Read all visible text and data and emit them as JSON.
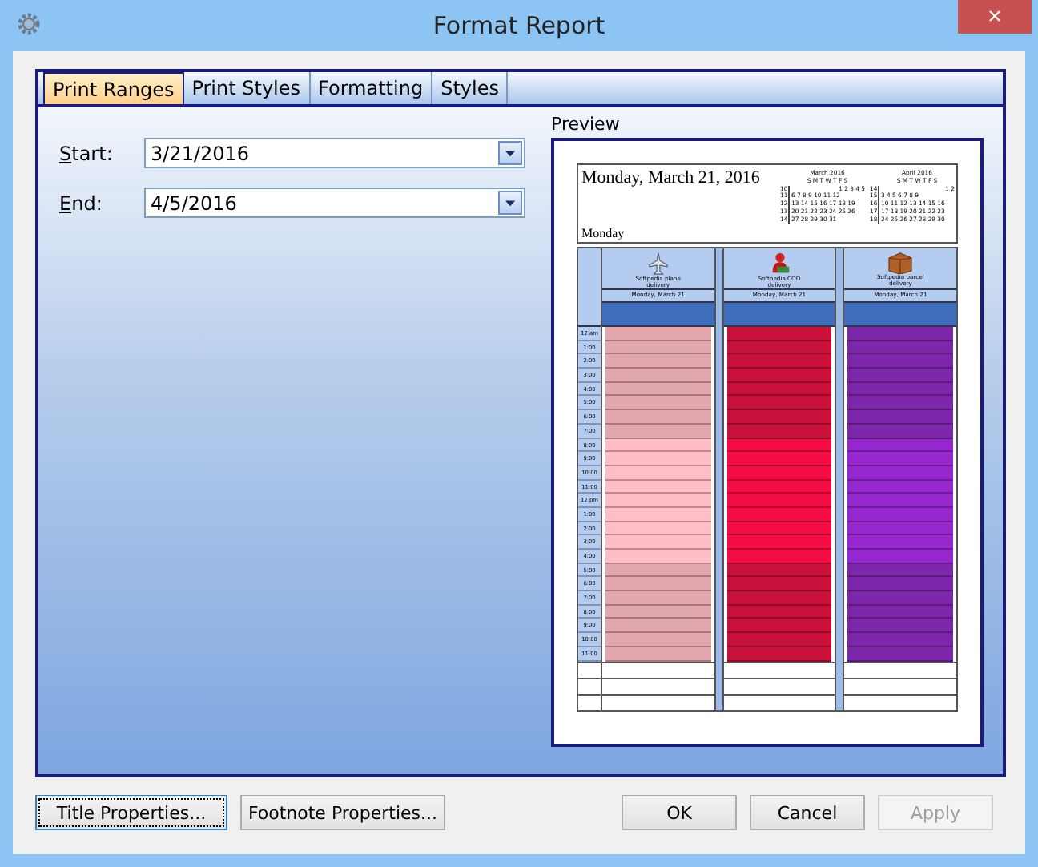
{
  "window": {
    "title": "Format Report",
    "close": "×"
  },
  "tabs": [
    {
      "label": "Print Ranges",
      "selected": true
    },
    {
      "label": "Print Styles",
      "selected": false
    },
    {
      "label": "Formatting",
      "selected": false
    },
    {
      "label": "Styles",
      "selected": false
    }
  ],
  "fields": [
    {
      "label": "Start:",
      "value": "3/21/2016"
    },
    {
      "label": "End:",
      "value": "4/5/2016"
    }
  ],
  "preview": {
    "label": "Preview",
    "header": {
      "title": "Monday, March 21, 2016",
      "subtitle": "Monday",
      "calendars": [
        {
          "month": "March 2016",
          "weekdays": [
            "S",
            "M",
            "T",
            "W",
            "T",
            "F",
            "S"
          ],
          "weeks": [
            {
              "num": "10",
              "days": [
                "1",
                "2",
                "3",
                "4",
                "5"
              ],
              "kind": "first"
            },
            {
              "num": "11",
              "days": [
                "6",
                "7",
                "8",
                "9",
                "10",
                "11",
                "12"
              ],
              "kind": "full"
            },
            {
              "num": "12",
              "days": [
                "13",
                "14",
                "15",
                "16",
                "17",
                "18",
                "19"
              ],
              "kind": "full"
            },
            {
              "num": "13",
              "days": [
                "20",
                "21",
                "22",
                "23",
                "24",
                "25",
                "26"
              ],
              "kind": "full"
            },
            {
              "num": "14",
              "days": [
                "27",
                "28",
                "29",
                "30",
                "31"
              ],
              "kind": "last"
            }
          ]
        },
        {
          "month": "April 2016",
          "weekdays": [
            "S",
            "M",
            "T",
            "W",
            "T",
            "F",
            "S"
          ],
          "weeks": [
            {
              "num": "14",
              "days": [
                "1",
                "2"
              ],
              "kind": "first"
            },
            {
              "num": "15",
              "days": [
                "3",
                "4",
                "5",
                "6",
                "7",
                "8",
                "9"
              ],
              "kind": "full"
            },
            {
              "num": "16",
              "days": [
                "10",
                "11",
                "12",
                "13",
                "14",
                "15",
                "16"
              ],
              "kind": "full"
            },
            {
              "num": "17",
              "days": [
                "17",
                "18",
                "19",
                "20",
                "21",
                "22",
                "23"
              ],
              "kind": "full"
            },
            {
              "num": "18",
              "days": [
                "24",
                "25",
                "26",
                "27",
                "28",
                "29",
                "30"
              ],
              "kind": "full"
            }
          ]
        }
      ]
    },
    "resources": [
      {
        "name": "Softpedia plane delivery",
        "date": "Monday, March 21",
        "kind": "plane",
        "color": "#e3a7b0"
      },
      {
        "name": "Softpedia COD delivery",
        "date": "Monday, March 21",
        "kind": "courier",
        "color": "#c8103a"
      },
      {
        "name": "Softpedia parcel delivery",
        "date": "Monday, March 21",
        "kind": "parcel",
        "color": "#7d27ab"
      }
    ],
    "time_slots": [
      {
        "label": "12 am",
        "work": false
      },
      {
        "label": "1:00",
        "work": false
      },
      {
        "label": "2:00",
        "work": false
      },
      {
        "label": "3:00",
        "work": false
      },
      {
        "label": "4:00",
        "work": false
      },
      {
        "label": "5:00",
        "work": false
      },
      {
        "label": "6:00",
        "work": false
      },
      {
        "label": "7:00",
        "work": false
      },
      {
        "label": "8:00",
        "work": true
      },
      {
        "label": "9:00",
        "work": true
      },
      {
        "label": "10:00",
        "work": true
      },
      {
        "label": "11:00",
        "work": true
      },
      {
        "label": "12 pm",
        "work": true
      },
      {
        "label": "1:00",
        "work": true
      },
      {
        "label": "2:00",
        "work": true
      },
      {
        "label": "3:00",
        "work": true
      },
      {
        "label": "4:00",
        "work": true
      },
      {
        "label": "5:00",
        "work": false
      },
      {
        "label": "6:00",
        "work": false
      },
      {
        "label": "7:00",
        "work": false
      },
      {
        "label": "8:00",
        "work": false
      },
      {
        "label": "9:00",
        "work": false
      },
      {
        "label": "10:00",
        "work": false
      },
      {
        "label": "11:00",
        "work": false
      }
    ]
  },
  "buttons": [
    {
      "label": "Title Properties...",
      "kind": "focused",
      "disabled": false
    },
    {
      "label": "Footnote Properties...",
      "kind": "normal",
      "disabled": false
    },
    {
      "label": "OK",
      "kind": "normal",
      "disabled": false
    },
    {
      "label": "Cancel",
      "kind": "normal",
      "disabled": false
    },
    {
      "label": "Apply",
      "kind": "normal",
      "disabled": true
    }
  ]
}
